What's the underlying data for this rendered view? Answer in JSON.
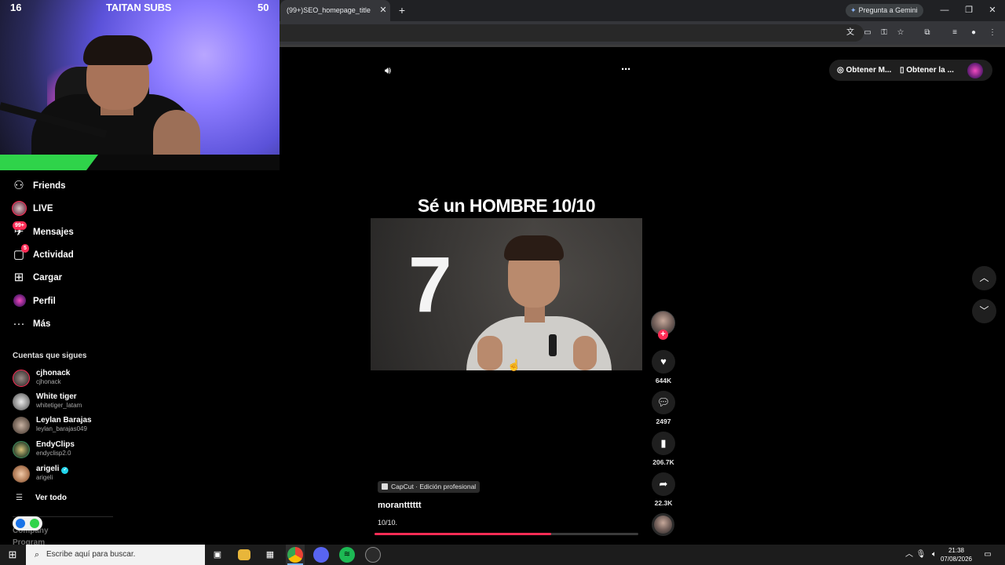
{
  "browser": {
    "tab_title": "(99+)SEO_homepage_title",
    "gemini_label": "Pregunta a Gemini"
  },
  "stream_overlay": {
    "left_number": "16",
    "title": "TAITAN SUBS",
    "right_number": "50"
  },
  "sidebar": {
    "items": [
      {
        "label": "Friends",
        "icon": "friends-icon"
      },
      {
        "label": "LIVE",
        "icon": "live-icon"
      },
      {
        "label": "Mensajes",
        "icon": "messages-icon",
        "badge": "99+"
      },
      {
        "label": "Actividad",
        "icon": "activity-icon",
        "badge": "5"
      },
      {
        "label": "Cargar",
        "icon": "upload-icon"
      },
      {
        "label": "Perfil",
        "icon": "profile-icon"
      },
      {
        "label": "Más",
        "icon": "more-icon"
      }
    ],
    "following_heading": "Cuentas que sigues",
    "accounts": [
      {
        "name": "cjhonack",
        "handle": "cjhonack",
        "verified": false
      },
      {
        "name": "White tiger",
        "handle": "whitetiger_latam",
        "verified": false
      },
      {
        "name": "Leylan Barajas",
        "handle": "leylan_barajas049",
        "verified": false
      },
      {
        "name": "EndyClips",
        "handle": "endyclisp2.0",
        "verified": false
      },
      {
        "name": "arigeli",
        "handle": "arigeli",
        "verified": true
      }
    ],
    "see_all": "Ver todo",
    "footer": [
      "Company",
      "Program"
    ]
  },
  "top_actions": {
    "get_m": "Obtener M...",
    "get_l": "Obtener la ..."
  },
  "video": {
    "caption_title": "Sé un HOMBRE 10/10",
    "overlay_number": "7",
    "effect_tag": "CapCut · Edición profesional",
    "author": "morantttttt",
    "description": "10/10.",
    "progress": 0.67,
    "likes": "644K",
    "comments": "2497",
    "saves": "206.7K",
    "shares": "22.3K"
  },
  "taskbar": {
    "search_placeholder": "Escribe aquí para buscar.",
    "time": "21:38",
    "date": "07/08/2026"
  },
  "colors": {
    "accent": "#fe2c55",
    "overlay_green": "#2fd34a",
    "background": "#000000"
  }
}
